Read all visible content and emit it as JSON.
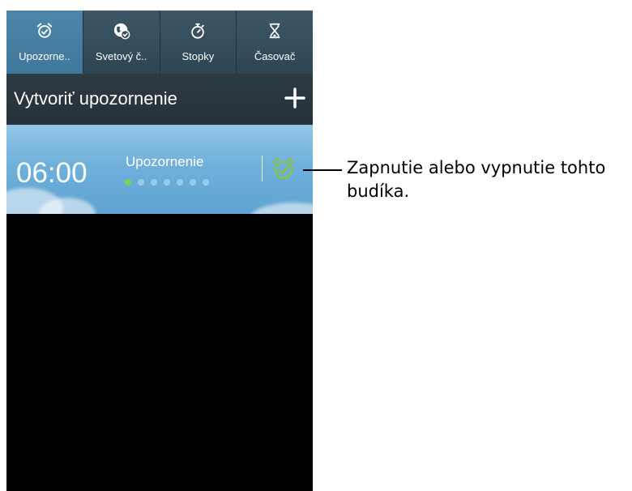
{
  "tabs": [
    {
      "label": "Upozorne..",
      "icon": "alarm-clock-icon",
      "active": true
    },
    {
      "label": "Svetový č..",
      "icon": "globe-check-icon",
      "active": false
    },
    {
      "label": "Stopky",
      "icon": "stopwatch-icon",
      "active": false
    },
    {
      "label": "Časovač",
      "icon": "hourglass-icon",
      "active": false
    }
  ],
  "actionbar": {
    "title": "Vytvoriť upozornenie",
    "add_icon": "plus-icon"
  },
  "alarm": {
    "time": "06:00",
    "name": "Upozornenie",
    "toggle_icon": "alarm-clock-icon",
    "toggle_on": true,
    "toggle_color": "#8bc53f"
  },
  "callout": {
    "text": "Zapnutie alebo vypnutie tohto budíka."
  },
  "colors": {
    "tab_active": "#4381a6",
    "tab_bar": "#34495a",
    "actionbar": "#29353d",
    "alarm_green": "#8bc53f"
  }
}
